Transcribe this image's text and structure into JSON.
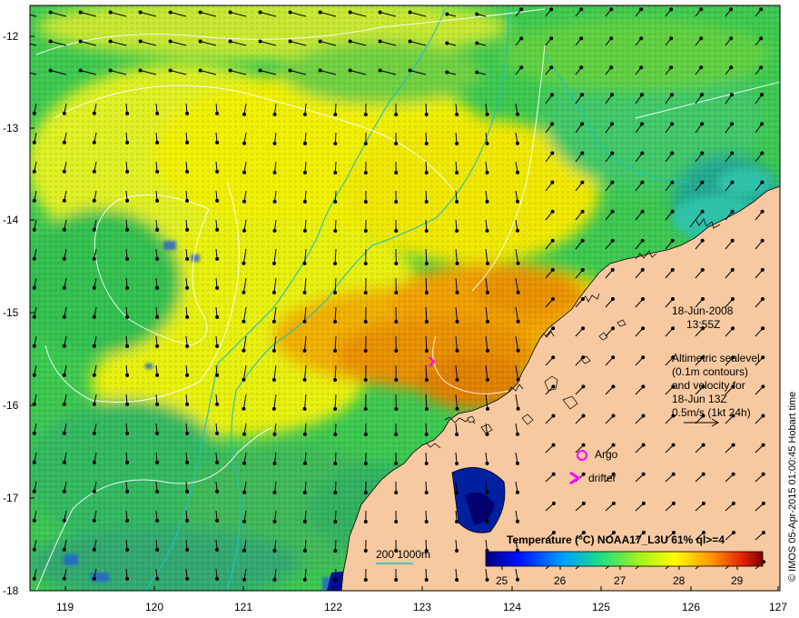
{
  "map": {
    "longitude_ticks": [
      "119",
      "120",
      "121",
      "122",
      "123",
      "124",
      "125",
      "126",
      "127"
    ],
    "latitude_ticks": [
      "-12",
      "-13",
      "-14",
      "-15",
      "-16",
      "-17",
      "-18"
    ],
    "lon_range": [
      118.6,
      127
    ],
    "lat_range": [
      -18,
      -11.8
    ]
  },
  "annotation": {
    "date": "18-Jun-2008",
    "time": "13:55Z",
    "altimetry_lines": [
      "Altimetric sealevel",
      "(0.1m contours)",
      "and velocity for",
      "18-Jun 13Z",
      "0.5m/s (1kt 24h)"
    ],
    "argo_label": "Argo",
    "drifter_label": "drifter",
    "depth_label": "200  1000m",
    "credit": "© IMOS 05-Apr-2015 01:00:45 Hobart time"
  },
  "colorbar": {
    "title": "Temperature (°C) NOAA17_L3U 61% ql>=4",
    "ticks": [
      "25",
      "26",
      "27",
      "28",
      "29"
    ],
    "range": [
      24.6,
      29.4
    ]
  },
  "colors": {
    "land": "#f7c9a0",
    "argo": "#ff00ff",
    "drifter": "#ff00ff",
    "contour_200m": "#20c0c0",
    "sealevel_contour": "#ffffff",
    "arrow": "#000000"
  }
}
